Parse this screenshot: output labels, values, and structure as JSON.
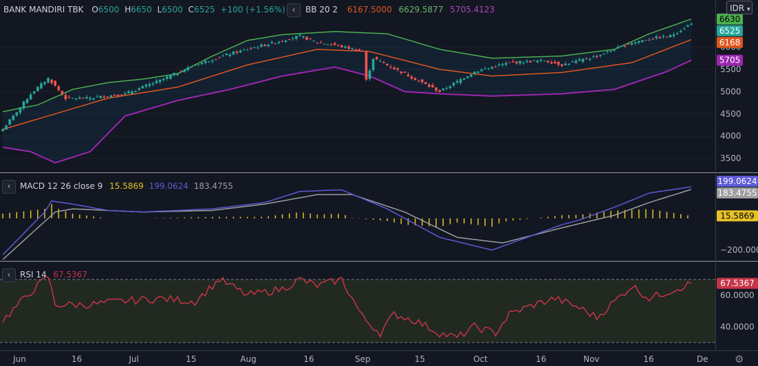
{
  "header": {
    "symbol": "BANK MANDIRI TBK",
    "o_label": "O",
    "o_value": "6500",
    "h_label": "H",
    "h_value": "6650",
    "l_label": "L",
    "l_value": "6500",
    "c_label": "C",
    "c_value": "6525",
    "change": "+100 (+1.56%)",
    "bb_label": "BB 20 2",
    "bb_middle": "6167.5000",
    "bb_upper": "6629.5877",
    "bb_lower": "5705.4123",
    "currency": "IDR"
  },
  "macd_header": {
    "label": "MACD 12 26 close 9",
    "hist": "15.5869",
    "macd": "199.0624",
    "signal": "183.4755"
  },
  "rsi_header": {
    "label": "RSI 14",
    "value": "67.5367"
  },
  "x_ticks": [
    "Jun",
    "16",
    "Jul",
    "15",
    "Aug",
    "16",
    "Sep",
    "15",
    "Oct",
    "16",
    "Nov",
    "16",
    "De"
  ],
  "colors": {
    "up": "#26a69a",
    "down": "#ef5350",
    "bb_upper": "#4caf50",
    "bb_middle": "#e0571f",
    "bb_lower": "#9c27b0",
    "macd": "#5d5bd6",
    "signal": "#9e9e9e",
    "hist": "#e6c229",
    "rsi": "#c73447",
    "bg": "#131722"
  },
  "chart_data": [
    {
      "type": "candlestick",
      "title": "BANK MANDIRI TBK",
      "y_ticks": [
        3500,
        4000,
        4500,
        5000,
        5500,
        6000
      ],
      "ylim": [
        3200,
        6750
      ],
      "x_tick_labels": [
        "Jun",
        "16",
        "Jul",
        "15",
        "Aug",
        "16",
        "Sep",
        "15",
        "Oct",
        "16",
        "Nov",
        "16",
        "De"
      ],
      "last_close": 6525,
      "price_labels": {
        "bb_upper": "6630",
        "close": "6525",
        "bb_middle": "6168",
        "bb_lower": "5705"
      },
      "close_anchors": [
        [
          0,
          4150
        ],
        [
          8,
          4950
        ],
        [
          13,
          5300
        ],
        [
          18,
          4850
        ],
        [
          24,
          4850
        ],
        [
          35,
          4950
        ],
        [
          45,
          5250
        ],
        [
          55,
          5600
        ],
        [
          65,
          5850
        ],
        [
          75,
          6050
        ],
        [
          85,
          6250
        ],
        [
          90,
          6100
        ],
        [
          95,
          6050
        ],
        [
          103,
          5900
        ],
        [
          104,
          5250
        ],
        [
          106,
          5750
        ],
        [
          115,
          5400
        ],
        [
          125,
          5000
        ],
        [
          135,
          5450
        ],
        [
          145,
          5650
        ],
        [
          155,
          5700
        ],
        [
          160,
          5600
        ],
        [
          170,
          5800
        ],
        [
          180,
          6100
        ],
        [
          186,
          6200
        ],
        [
          191,
          6250
        ],
        [
          197,
          6525
        ]
      ],
      "bollinger": {
        "period": 20,
        "stddev": 2,
        "upper_anchors": [
          [
            0,
            4550
          ],
          [
            10,
            4700
          ],
          [
            20,
            5050
          ],
          [
            30,
            5200
          ],
          [
            40,
            5280
          ],
          [
            50,
            5400
          ],
          [
            60,
            5800
          ],
          [
            70,
            6150
          ],
          [
            80,
            6280
          ],
          [
            95,
            6350
          ],
          [
            110,
            6300
          ],
          [
            125,
            5950
          ],
          [
            140,
            5750
          ],
          [
            160,
            5800
          ],
          [
            175,
            5950
          ],
          [
            185,
            6300
          ],
          [
            197,
            6630
          ]
        ],
        "middle_anchors": [
          [
            0,
            4150
          ],
          [
            15,
            4500
          ],
          [
            30,
            4850
          ],
          [
            50,
            5100
          ],
          [
            70,
            5600
          ],
          [
            90,
            5950
          ],
          [
            105,
            5900
          ],
          [
            125,
            5500
          ],
          [
            140,
            5350
          ],
          [
            160,
            5430
          ],
          [
            180,
            5650
          ],
          [
            197,
            6168
          ]
        ],
        "lower_anchors": [
          [
            0,
            3750
          ],
          [
            8,
            3650
          ],
          [
            15,
            3400
          ],
          [
            25,
            3650
          ],
          [
            35,
            4450
          ],
          [
            50,
            4800
          ],
          [
            65,
            5050
          ],
          [
            80,
            5350
          ],
          [
            95,
            5550
          ],
          [
            105,
            5350
          ],
          [
            115,
            5000
          ],
          [
            125,
            4950
          ],
          [
            140,
            4900
          ],
          [
            160,
            4950
          ],
          [
            175,
            5050
          ],
          [
            190,
            5450
          ],
          [
            197,
            5705
          ]
        ]
      }
    },
    {
      "type": "line",
      "title": "MACD 12 26 close 9",
      "y_ticks": [
        -200
      ],
      "ylim": [
        -260,
        260
      ],
      "macd_anchors": [
        [
          0,
          -230
        ],
        [
          12,
          40
        ],
        [
          14,
          110
        ],
        [
          20,
          90
        ],
        [
          30,
          50
        ],
        [
          40,
          40
        ],
        [
          60,
          60
        ],
        [
          75,
          100
        ],
        [
          85,
          170
        ],
        [
          97,
          180
        ],
        [
          110,
          60
        ],
        [
          125,
          -120
        ],
        [
          140,
          -200
        ],
        [
          150,
          -120
        ],
        [
          160,
          -40
        ],
        [
          165,
          -10
        ],
        [
          175,
          70
        ],
        [
          185,
          160
        ],
        [
          197,
          199
        ]
      ],
      "signal_anchors": [
        [
          0,
          -260
        ],
        [
          15,
          40
        ],
        [
          20,
          60
        ],
        [
          40,
          40
        ],
        [
          60,
          50
        ],
        [
          75,
          90
        ],
        [
          90,
          150
        ],
        [
          100,
          150
        ],
        [
          115,
          40
        ],
        [
          130,
          -120
        ],
        [
          143,
          -155
        ],
        [
          160,
          -60
        ],
        [
          175,
          20
        ],
        [
          185,
          100
        ],
        [
          197,
          183
        ]
      ],
      "last_macd": 199.0624,
      "last_signal": 183.4755,
      "last_hist": 15.5869
    },
    {
      "type": "line",
      "title": "RSI 14",
      "y_ticks": [
        40,
        60
      ],
      "ylim": [
        26,
        80
      ],
      "bands": [
        30,
        70
      ],
      "anchors": [
        [
          0,
          44
        ],
        [
          8,
          62
        ],
        [
          13,
          72
        ],
        [
          15,
          54
        ],
        [
          25,
          54
        ],
        [
          33,
          56
        ],
        [
          45,
          58
        ],
        [
          55,
          56
        ],
        [
          62,
          70
        ],
        [
          70,
          60
        ],
        [
          80,
          64
        ],
        [
          85,
          70
        ],
        [
          90,
          66
        ],
        [
          97,
          70
        ],
        [
          103,
          46
        ],
        [
          108,
          36
        ],
        [
          112,
          48
        ],
        [
          118,
          44
        ],
        [
          125,
          36
        ],
        [
          130,
          33
        ],
        [
          135,
          40
        ],
        [
          141,
          36
        ],
        [
          145,
          48
        ],
        [
          152,
          54
        ],
        [
          158,
          58
        ],
        [
          165,
          52
        ],
        [
          170,
          46
        ],
        [
          175,
          56
        ],
        [
          180,
          66
        ],
        [
          185,
          58
        ],
        [
          190,
          62
        ],
        [
          197,
          67.5
        ]
      ],
      "last_value": 67.5367
    }
  ]
}
